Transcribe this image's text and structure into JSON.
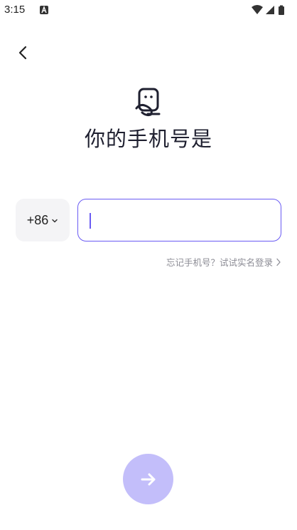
{
  "status_bar": {
    "time": "3:15",
    "notification_icon": "a-letter-icon",
    "wifi_icon": "wifi-icon",
    "signal_icon": "cell-signal-icon",
    "battery_icon": "battery-icon"
  },
  "header": {
    "back_icon": "chevron-left-icon"
  },
  "main": {
    "logo_icon": "app-logo-icon",
    "title": "你的手机号是",
    "country_code": "+86",
    "phone_value": "",
    "forgot_link": "忘记手机号？试试实名登录"
  },
  "colors": {
    "accent": "#6a5bf3",
    "next_button": "#c3befa",
    "country_bg": "#f4f4f6",
    "muted_text": "#8c8c95",
    "title_text": "#1f2030"
  }
}
